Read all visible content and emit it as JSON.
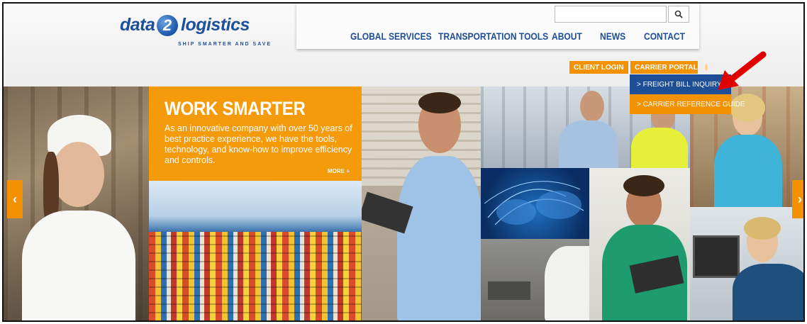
{
  "brand": {
    "word1": "data",
    "number": "2",
    "word2": "logistics",
    "tagline": "SHIP SMARTER AND SAVE"
  },
  "search": {
    "placeholder": "",
    "button_icon": "search-icon"
  },
  "nav": {
    "items": [
      {
        "label": "GLOBAL SERVICES"
      },
      {
        "label": "TRANSPORTATION TOOLS"
      },
      {
        "label": "ABOUT"
      },
      {
        "label": "NEWS"
      },
      {
        "label": "CONTACT"
      }
    ]
  },
  "portals": {
    "client_login": "CLIENT LOGIN",
    "carrier_portal": "CARRIER PORTAL"
  },
  "dropdown": {
    "items": [
      {
        "label": "> FREIGHT BILL INQUIRY",
        "active": true
      },
      {
        "label": "> CARRIER REFERENCE GUIDE",
        "active": false
      }
    ]
  },
  "promo": {
    "title": "WORK SMARTER",
    "body": "As an innovative company with over 50 years of best practice experience, we have the tools, technology, and know-how to improve efficiency and controls.",
    "more": "MORE +"
  },
  "slider": {
    "prev_icon": "chevron-left-icon",
    "next_icon": "chevron-right-icon",
    "prev_glyph": "‹",
    "next_glyph": "›"
  },
  "colors": {
    "brand_blue": "#1e4e96",
    "accent_orange": "#f39200",
    "annotation_red": "#e00000"
  }
}
